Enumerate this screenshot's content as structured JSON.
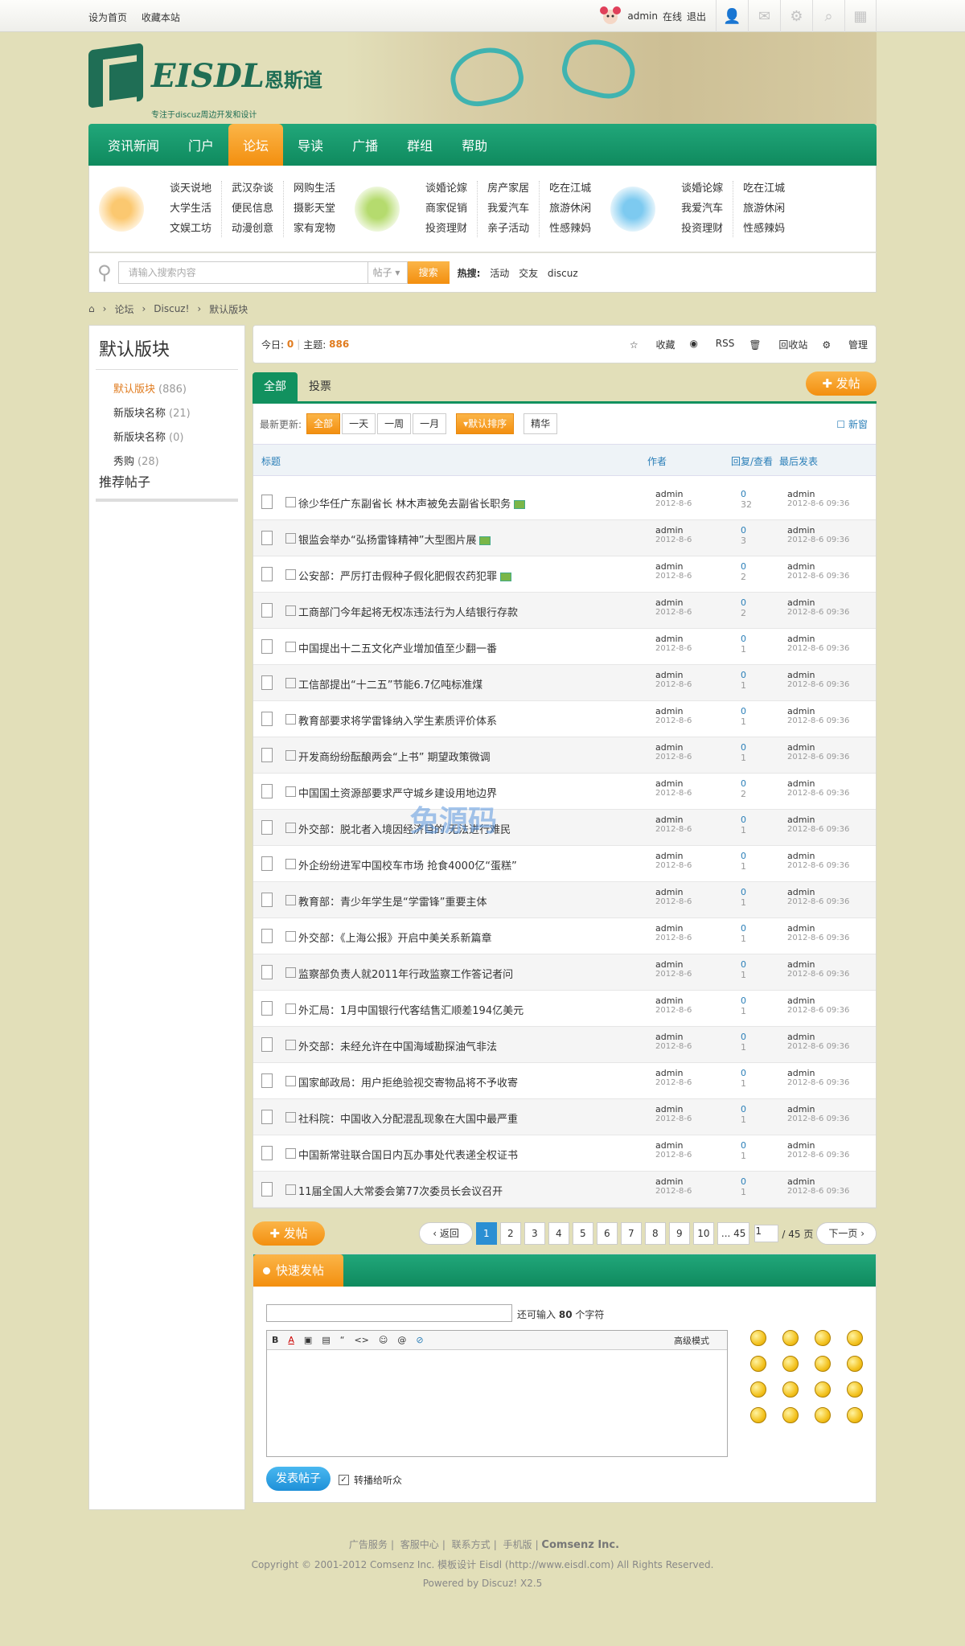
{
  "topbar": {
    "links": [
      "设为首页",
      "收藏本站"
    ],
    "user": "admin",
    "status": "在线",
    "logout": "退出"
  },
  "brand": {
    "name": "EISDL",
    "cn_name": "恩斯道",
    "tagline": "专注于discuz周边开发和设计"
  },
  "nav": [
    "资讯新闻",
    "门户",
    "论坛",
    "导读",
    "广播",
    "群组",
    "帮助"
  ],
  "menu": {
    "groups": [
      {
        "icon": "box-icon",
        "color": "#f39c1f",
        "cols": [
          [
            "谈天说地",
            "大学生活",
            "文娱工坊"
          ],
          [
            "武汉杂谈",
            "便民信息",
            "动漫创意"
          ],
          [
            "网购生活",
            "摄影天堂",
            "家有宠物"
          ]
        ]
      },
      {
        "icon": "coffee-icon",
        "color": "#8cc63f",
        "cols": [
          [
            "谈婚论嫁",
            "商家促销",
            "投资理财"
          ],
          [
            "房产家居",
            "我爱汽车",
            "亲子活动"
          ],
          [
            "吃在江城",
            "旅游休闲",
            "性感辣妈"
          ]
        ]
      },
      {
        "icon": "cloud-icon",
        "color": "#3aa8e0",
        "cols": [
          [
            "谈婚论嫁",
            "我爱汽车",
            "投资理财"
          ],
          [
            "吃在江城",
            "旅游休闲",
            "性感辣妈"
          ]
        ]
      }
    ]
  },
  "search": {
    "placeholder": "请输入搜索内容",
    "select": "帖子",
    "button": "搜索",
    "hot_label": "热搜:",
    "hot": [
      "活动",
      "交友",
      "discuz"
    ]
  },
  "breadcrumb": [
    "论坛",
    "Discuz!",
    "默认版块"
  ],
  "sidebar": {
    "title": "默认版块",
    "items": [
      {
        "label": "默认版块",
        "count": "(886)"
      },
      {
        "label": "新版块名称",
        "count": "(21)"
      },
      {
        "label": "新版块名称",
        "count": "(0)"
      },
      {
        "label": "秀购",
        "count": "(28)"
      }
    ],
    "recommend": "推荐帖子"
  },
  "stats": {
    "today_label": "今日:",
    "today": "0",
    "topics_label": "主题:",
    "topics": "886",
    "actions": [
      "收藏",
      "RSS",
      "回收站",
      "管理"
    ]
  },
  "tabs": [
    "全部",
    "投票"
  ],
  "post_button": "发帖",
  "filter": {
    "label": "最新更新:",
    "options": [
      "全部",
      "一天",
      "一周",
      "一月"
    ],
    "order": "默认排序",
    "digest": "精华",
    "newwin": "新窗"
  },
  "table": {
    "headers": [
      "标题",
      "作者",
      "回复/查看",
      "最后发表"
    ],
    "rows": [
      {
        "title": "徐少华任广东副省长 林木声被免去副省长职务",
        "img": true,
        "author": "admin",
        "date": "2012-8-6",
        "replies": "0",
        "views": "32",
        "last": "admin",
        "last_date": "2012-8-6 09:36"
      },
      {
        "title": "银监会举办“弘扬雷锋精神”大型图片展",
        "img": true,
        "author": "admin",
        "date": "2012-8-6",
        "replies": "0",
        "views": "3",
        "last": "admin",
        "last_date": "2012-8-6 09:36"
      },
      {
        "title": "公安部：严厉打击假种子假化肥假农药犯罪",
        "img": true,
        "author": "admin",
        "date": "2012-8-6",
        "replies": "0",
        "views": "2",
        "last": "admin",
        "last_date": "2012-8-6 09:36"
      },
      {
        "title": "工商部门今年起将无权冻违法行为人结银行存款",
        "img": false,
        "author": "admin",
        "date": "2012-8-6",
        "replies": "0",
        "views": "2",
        "last": "admin",
        "last_date": "2012-8-6 09:36"
      },
      {
        "title": "中国提出十二五文化产业增加值至少翻一番",
        "img": false,
        "author": "admin",
        "date": "2012-8-6",
        "replies": "0",
        "views": "1",
        "last": "admin",
        "last_date": "2012-8-6 09:36"
      },
      {
        "title": "工信部提出“十二五”节能6.7亿吨标准煤",
        "img": false,
        "author": "admin",
        "date": "2012-8-6",
        "replies": "0",
        "views": "1",
        "last": "admin",
        "last_date": "2012-8-6 09:36"
      },
      {
        "title": "教育部要求将学雷锋纳入学生素质评价体系",
        "img": false,
        "author": "admin",
        "date": "2012-8-6",
        "replies": "0",
        "views": "1",
        "last": "admin",
        "last_date": "2012-8-6 09:36"
      },
      {
        "title": "开发商纷纷酝酿两会“上书” 期望政策微调",
        "img": false,
        "author": "admin",
        "date": "2012-8-6",
        "replies": "0",
        "views": "1",
        "last": "admin",
        "last_date": "2012-8-6 09:36"
      },
      {
        "title": "中国国土资源部要求严守城乡建设用地边界",
        "img": false,
        "author": "admin",
        "date": "2012-8-6",
        "replies": "0",
        "views": "2",
        "last": "admin",
        "last_date": "2012-8-6 09:36"
      },
      {
        "title": "外交部：脱北者入境因经济目的 无法进行难民",
        "img": false,
        "author": "admin",
        "date": "2012-8-6",
        "replies": "0",
        "views": "1",
        "last": "admin",
        "last_date": "2012-8-6 09:36"
      },
      {
        "title": "外企纷纷进军中国校车市场 抢食4000亿“蛋糕”",
        "img": false,
        "author": "admin",
        "date": "2012-8-6",
        "replies": "0",
        "views": "1",
        "last": "admin",
        "last_date": "2012-8-6 09:36"
      },
      {
        "title": "教育部：青少年学生是“学雷锋”重要主体",
        "img": false,
        "author": "admin",
        "date": "2012-8-6",
        "replies": "0",
        "views": "1",
        "last": "admin",
        "last_date": "2012-8-6 09:36"
      },
      {
        "title": "外交部：《上海公报》开启中美关系新篇章",
        "img": false,
        "author": "admin",
        "date": "2012-8-6",
        "replies": "0",
        "views": "1",
        "last": "admin",
        "last_date": "2012-8-6 09:36"
      },
      {
        "title": "监察部负责人就2011年行政监察工作答记者问",
        "img": false,
        "author": "admin",
        "date": "2012-8-6",
        "replies": "0",
        "views": "1",
        "last": "admin",
        "last_date": "2012-8-6 09:36"
      },
      {
        "title": "外汇局：1月中国银行代客结售汇顺差194亿美元",
        "img": false,
        "author": "admin",
        "date": "2012-8-6",
        "replies": "0",
        "views": "1",
        "last": "admin",
        "last_date": "2012-8-6 09:36"
      },
      {
        "title": "外交部：未经允许在中国海域勘探油气非法",
        "img": false,
        "author": "admin",
        "date": "2012-8-6",
        "replies": "0",
        "views": "1",
        "last": "admin",
        "last_date": "2012-8-6 09:36"
      },
      {
        "title": "国家邮政局：用户拒绝验视交寄物品将不予收寄",
        "img": false,
        "author": "admin",
        "date": "2012-8-6",
        "replies": "0",
        "views": "1",
        "last": "admin",
        "last_date": "2012-8-6 09:36"
      },
      {
        "title": "社科院：中国收入分配混乱现象在大国中最严重",
        "img": false,
        "author": "admin",
        "date": "2012-8-6",
        "replies": "0",
        "views": "1",
        "last": "admin",
        "last_date": "2012-8-6 09:36"
      },
      {
        "title": "中国新常驻联合国日内瓦办事处代表递全权证书",
        "img": false,
        "author": "admin",
        "date": "2012-8-6",
        "replies": "0",
        "views": "1",
        "last": "admin",
        "last_date": "2012-8-6 09:36"
      },
      {
        "title": "11届全国人大常委会第77次委员长会议召开",
        "img": false,
        "author": "admin",
        "date": "2012-8-6",
        "replies": "0",
        "views": "1",
        "last": "admin",
        "last_date": "2012-8-6 09:36"
      }
    ]
  },
  "pager": {
    "back": "返回",
    "pages": [
      "1",
      "2",
      "3",
      "4",
      "5",
      "6",
      "7",
      "8",
      "9",
      "10",
      "... 45"
    ],
    "input": "1",
    "total": "/ 45 页",
    "next": "下一页"
  },
  "quickpost": {
    "title": "快速发帖",
    "remain_label": "还可输入",
    "remain": "80",
    "remain_unit": "个字符",
    "toolbar": [
      "B",
      "A",
      "▣",
      "▤",
      "“",
      "<>",
      "☺",
      "@",
      "⊘"
    ],
    "adv": "高级模式",
    "submit": "发表帖子",
    "check": "转播给听众"
  },
  "footer": {
    "links": [
      "广告服务",
      "客服中心",
      "联系方式",
      "手机版"
    ],
    "company": "Comsenz Inc.",
    "copyright": "Copyright © 2001-2012 Comsenz Inc. 模板设计 Eisdl (http://www.eisdl.com) All Rights Reserved.",
    "powered": "Powered by Discuz! X2.5"
  },
  "watermark": "兔源码"
}
